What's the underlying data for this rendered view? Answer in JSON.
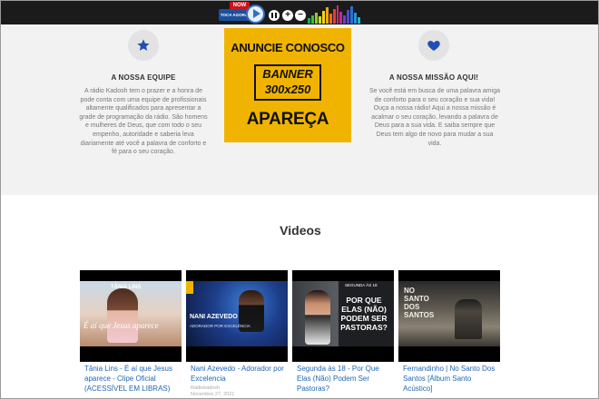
{
  "player": {
    "now_badge": "NOW",
    "station_label": "TOCA AGORA",
    "plus_label": "+",
    "minus_label": "−",
    "eq_colors": [
      "#19b34a",
      "#3fbf3a",
      "#8fd02a",
      "#cfe11a",
      "#f5d21a",
      "#f7a51c",
      "#f26b1f",
      "#e83a3a",
      "#d6276d",
      "#b32fa6",
      "#7d39c1",
      "#4a4bd0",
      "#2e6fd6",
      "#2296d8",
      "#21b7c9"
    ]
  },
  "left_column": {
    "icon": "star-icon",
    "title": "A NOSSA EQUIPE",
    "text": "A rádio Kadosh tem o prazer e a honra de pode conta com uma equipe de profissionais altamente qualificados para apresentar a grade de programação da rádio. São homens e mulheres de Deus, que com todo o seu empenho, autoridade e saberia leva diariamente até você a palavra de conforto e fé para o seu coração."
  },
  "banner": {
    "top": "ANUNCIE CONOSCO",
    "line1": "BANNER",
    "line2": "300x250",
    "bottom": "APAREÇA"
  },
  "right_column": {
    "icon": "heart-icon",
    "title": "A NOSSA MISSÃO AQUI!",
    "text": "Se você está em busca de uma palavra amiga de conforto para o seu coração e sua vida! Ouça a nossa rádio! Aqui a nossa missão é acalmar o seu coração, levando a palavra de Deus para a sua vida. E saiba sempre que Deus tem algo de novo para mudar a sua vida."
  },
  "videos": {
    "heading": "Videos",
    "items": [
      {
        "title": "Tânia Lins - É aí que Jesus aparece - Clipe Oficial (ACESSÍVEL EM LIBRAS)",
        "thumb_text": "TÂNIA LINS",
        "thumb_overlay": "É aí que Jesus aparece",
        "author": "",
        "date": ""
      },
      {
        "title": "Nani Azevedo - Adorador por Excelencia",
        "thumb_text": "NANI AZEVEDO",
        "thumb_overlay": "ADORADOR POR EXCELÊNCIA",
        "author": "Radiokadosh",
        "date": "Novembro 27, 2021"
      },
      {
        "title": "Segunda às 18 - Por Que Elas (Não) Podem Ser Pastoras?",
        "thumb_text": "SEGUNDA ÀS 18",
        "thumb_overlay": "POR QUE ELAS (NÃO) PODEM SER PASTORAS?",
        "author": "",
        "date": ""
      },
      {
        "title": "Fernandinho | No Santo Dos Santos [Álbum Santo Acústico]",
        "thumb_text": "NO SANTO DOS SANTOS",
        "thumb_overlay": "",
        "author": "",
        "date": ""
      }
    ]
  }
}
